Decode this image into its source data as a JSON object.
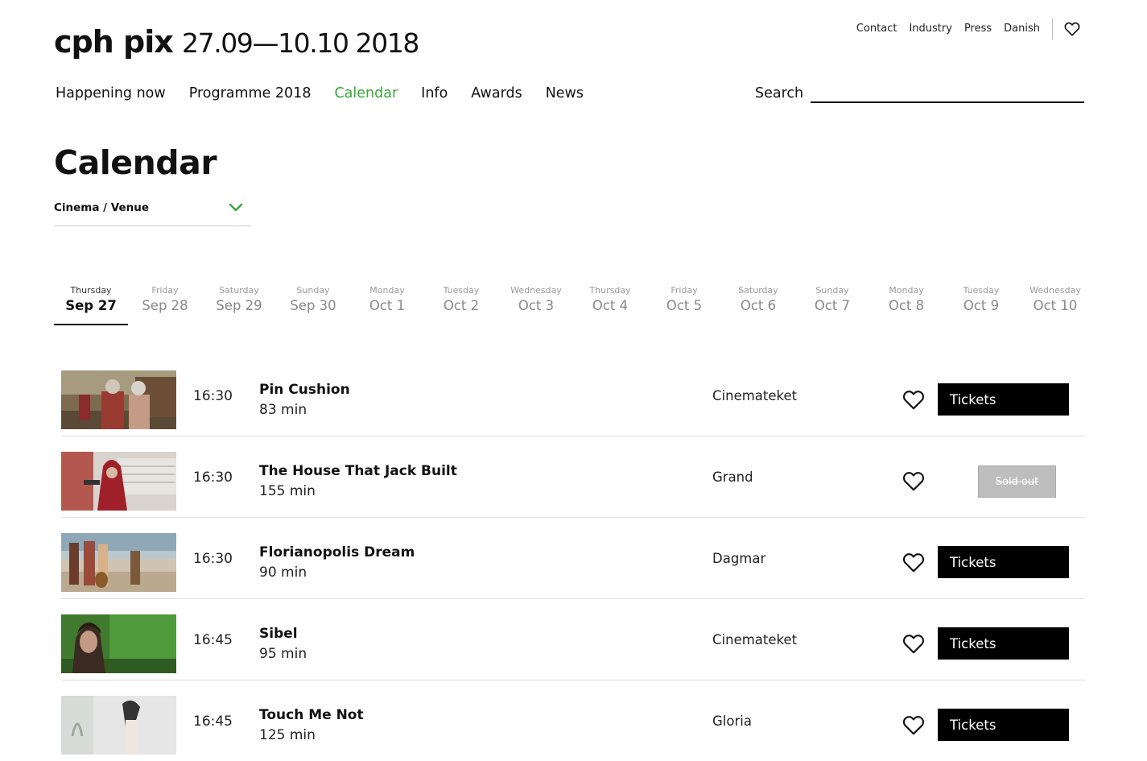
{
  "header": {
    "logo": "cph pix",
    "festival_dates": "27.09—10.10 2018",
    "utility_links": [
      "Contact",
      "Industry",
      "Press",
      "Danish"
    ],
    "favourites_icon": "heart-outline-icon"
  },
  "main_nav": [
    {
      "label": "Happening now",
      "active": false
    },
    {
      "label": "Programme 2018",
      "active": false
    },
    {
      "label": "Calendar",
      "active": true
    },
    {
      "label": "Info",
      "active": false
    },
    {
      "label": "Awards",
      "active": false
    },
    {
      "label": "News",
      "active": false
    }
  ],
  "search": {
    "label": "Search",
    "value": "",
    "placeholder": ""
  },
  "page_title": "Calendar",
  "venue_filter": {
    "label": "Cinema / Venue",
    "icon": "chevron-down-icon"
  },
  "dates": [
    {
      "weekday": "Thursday",
      "date": "Sep 27",
      "active": true
    },
    {
      "weekday": "Friday",
      "date": "Sep 28",
      "active": false
    },
    {
      "weekday": "Saturday",
      "date": "Sep 29",
      "active": false
    },
    {
      "weekday": "Sunday",
      "date": "Sep 30",
      "active": false
    },
    {
      "weekday": "Monday",
      "date": "Oct 1",
      "active": false
    },
    {
      "weekday": "Tuesday",
      "date": "Oct 2",
      "active": false
    },
    {
      "weekday": "Wednesday",
      "date": "Oct 3",
      "active": false
    },
    {
      "weekday": "Thursday",
      "date": "Oct 4",
      "active": false
    },
    {
      "weekday": "Friday",
      "date": "Oct 5",
      "active": false
    },
    {
      "weekday": "Saturday",
      "date": "Oct 6",
      "active": false
    },
    {
      "weekday": "Sunday",
      "date": "Oct 7",
      "active": false
    },
    {
      "weekday": "Monday",
      "date": "Oct 8",
      "active": false
    },
    {
      "weekday": "Tuesday",
      "date": "Oct 9",
      "active": false
    },
    {
      "weekday": "Wednesday",
      "date": "Oct 10",
      "active": false
    }
  ],
  "screenings": [
    {
      "time": "16:30",
      "title": "Pin Cushion",
      "duration": "83 min",
      "venue": "Cinemateket",
      "status": "tickets",
      "button": "Tickets"
    },
    {
      "time": "16:30",
      "title": "The House That Jack Built",
      "duration": "155 min",
      "venue": "Grand",
      "status": "soldout",
      "button": "Sold out"
    },
    {
      "time": "16:30",
      "title": "Florianopolis Dream",
      "duration": "90 min",
      "venue": "Dagmar",
      "status": "tickets",
      "button": "Tickets"
    },
    {
      "time": "16:45",
      "title": "Sibel",
      "duration": "95 min",
      "venue": "Cinemateket",
      "status": "tickets",
      "button": "Tickets"
    },
    {
      "time": "16:45",
      "title": "Touch Me Not",
      "duration": "125 min",
      "venue": "Gloria",
      "status": "tickets",
      "button": "Tickets"
    }
  ],
  "colors": {
    "accent": "#35a835",
    "button_bg": "#000000",
    "soldout_bg": "#bdbdbd"
  }
}
